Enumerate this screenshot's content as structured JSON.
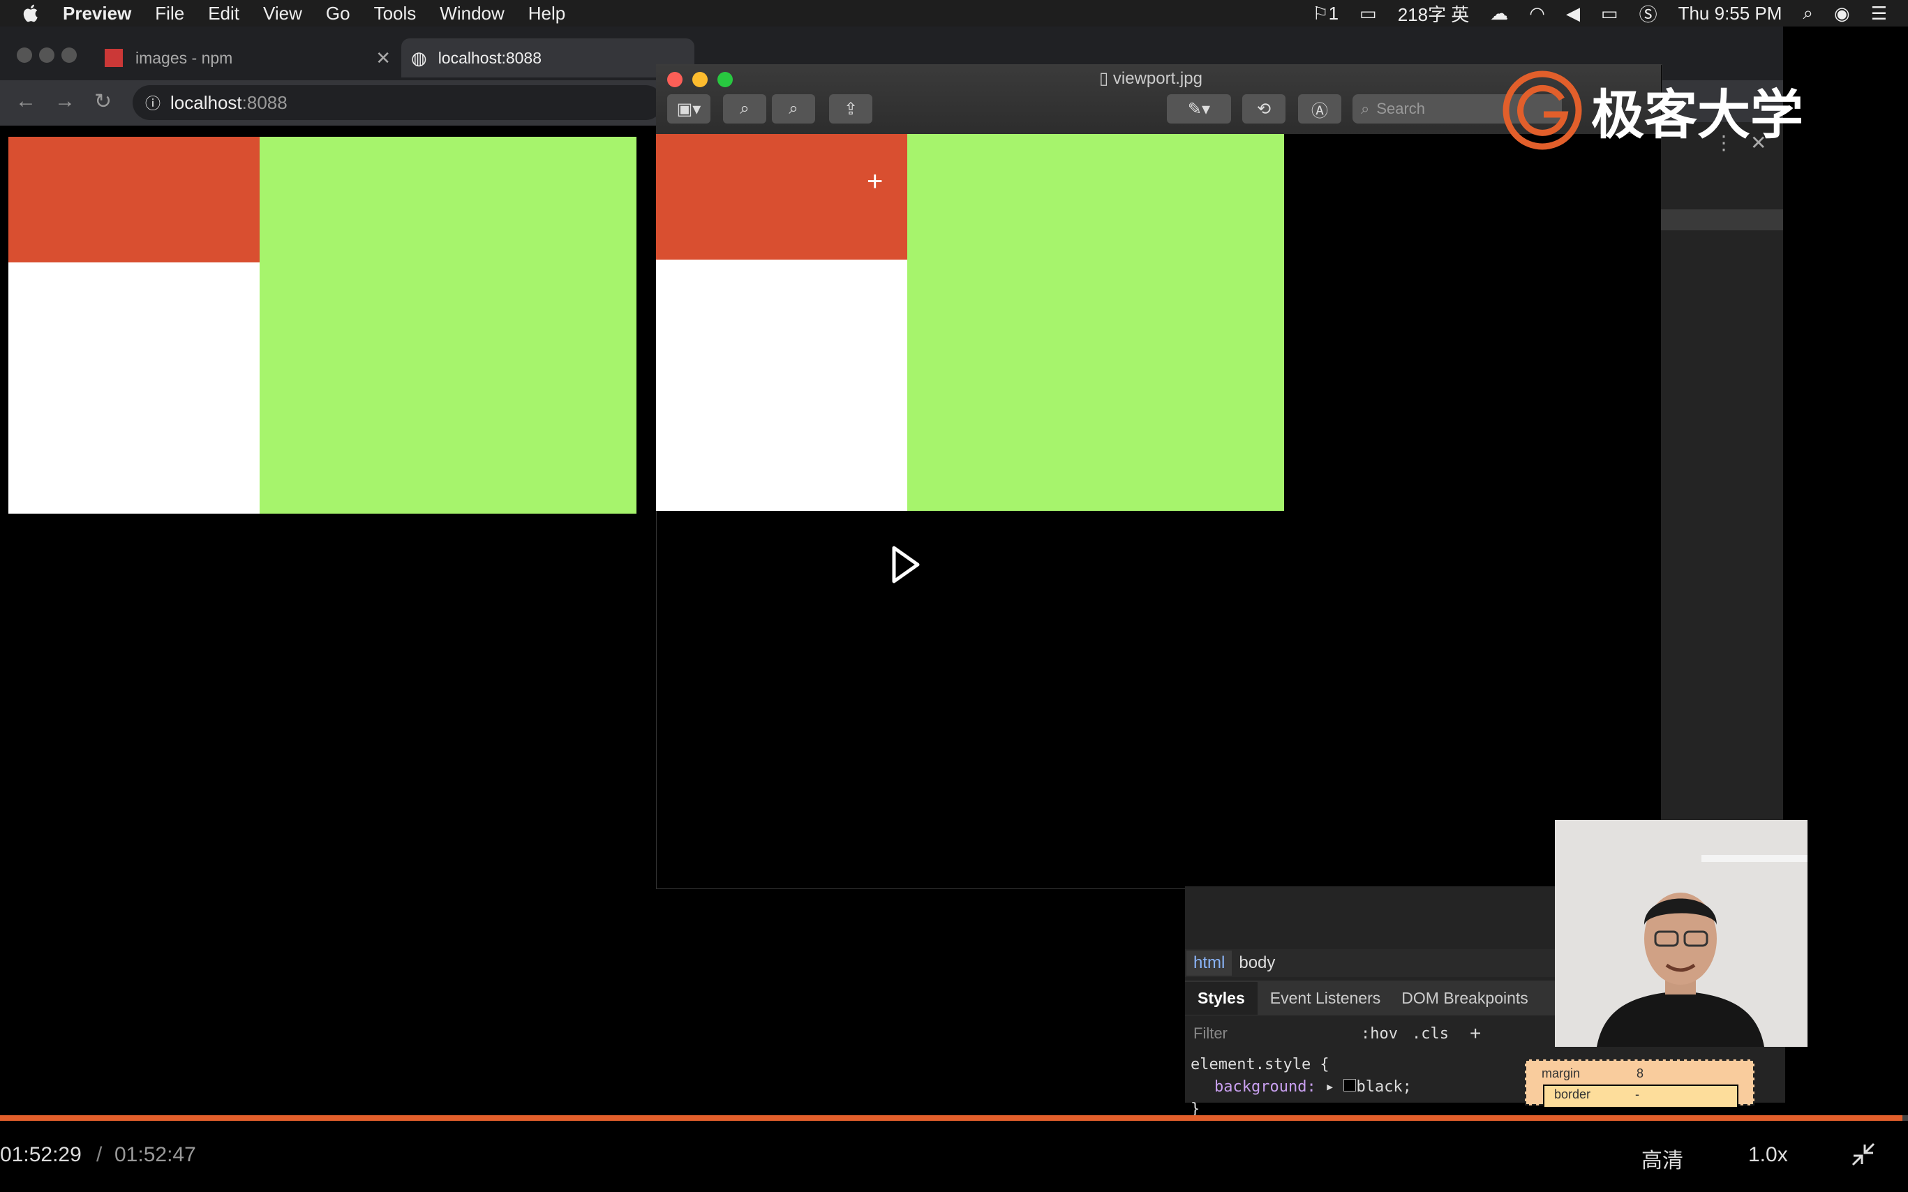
{
  "menubar": {
    "app": "Preview",
    "items": [
      "File",
      "Edit",
      "View",
      "Go",
      "Tools",
      "Window",
      "Help"
    ],
    "status": {
      "notif": "1",
      "word_count": "218字 英",
      "datetime": "Thu 9:55 PM"
    }
  },
  "browser": {
    "tabs": [
      {
        "label": "images - npm"
      },
      {
        "label": "localhost:8088"
      }
    ],
    "address": {
      "host": "localhost",
      "port": ":8088"
    }
  },
  "page_blocks": {
    "red": "#d94f30",
    "green": "#a6f46c",
    "white": "#ffffff"
  },
  "preview": {
    "filename": "viewport.jpg",
    "search_placeholder": "Search"
  },
  "logo": {
    "text": "极客大学"
  },
  "devtools": {
    "crumbs": [
      "html",
      "body"
    ],
    "tabs": [
      "Styles",
      "Event Listeners",
      "DOM Breakpoints"
    ],
    "filter_placeholder": "Filter",
    "hov": ":hov",
    "cls": ".cls",
    "code": {
      "selector": "element.style {",
      "prop": "background:",
      "value": "black;",
      "close": "}"
    },
    "box": {
      "margin": "margin",
      "margin_val": "8",
      "border": "border",
      "border_val": "-"
    }
  },
  "player": {
    "current": "01:52:29",
    "separator": "/",
    "total": "01:52:47",
    "quality": "高清",
    "speed": "1.0x",
    "progress_fraction": 0.997
  }
}
